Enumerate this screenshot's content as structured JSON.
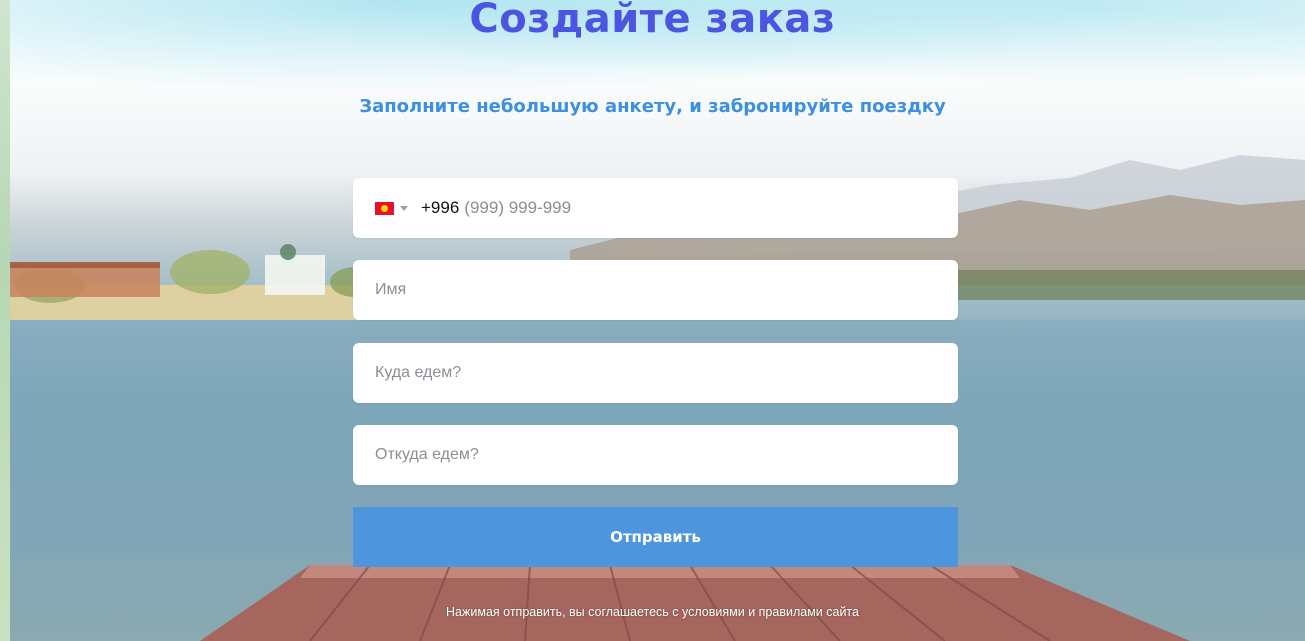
{
  "header": {
    "title": "Создайте заказ",
    "subtitle": "Заполните небольшую анкету, и забронируйте поездку"
  },
  "form": {
    "phone": {
      "country_flag": "kyrgyzstan-flag-icon",
      "country_code": "+996",
      "mask_placeholder": "(999) 999-999"
    },
    "name_placeholder": "Имя",
    "destination_placeholder": "Куда едем?",
    "origin_placeholder": "Откуда едем?",
    "submit_label": "Отправить",
    "terms_text": "Нажимая отправить, вы соглашаетесь с условиями и правилами сайта"
  },
  "colors": {
    "title": "#4b55e0",
    "subtitle": "#3d8fe0",
    "submit_button": "#4d95dd"
  }
}
